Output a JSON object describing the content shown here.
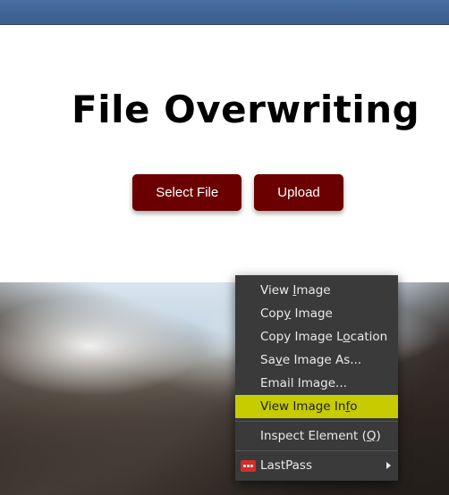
{
  "page": {
    "heading": "File Overwriting",
    "buttons": {
      "select_file": "Select File",
      "upload": "Upload"
    }
  },
  "context_menu": {
    "items": [
      {
        "prefix": "View ",
        "u": "I",
        "suffix": "mage"
      },
      {
        "prefix": "Cop",
        "u": "y",
        "suffix": " Image"
      },
      {
        "prefix": "Copy Image L",
        "u": "o",
        "suffix": "cation"
      },
      {
        "prefix": "Sa",
        "u": "v",
        "suffix": "e Image As..."
      },
      {
        "prefix": "Email Ima",
        "u": "g",
        "suffix": "e..."
      },
      {
        "prefix": "View Image In",
        "u": "f",
        "suffix": "o",
        "highlight": true
      },
      {
        "sep": true
      },
      {
        "prefix": "Inspect Element (",
        "u": "Q",
        "suffix": ")"
      },
      {
        "sep": true
      },
      {
        "prefix": "LastPass",
        "u": "",
        "suffix": "",
        "icon": "lastpass",
        "submenu": true
      }
    ]
  }
}
